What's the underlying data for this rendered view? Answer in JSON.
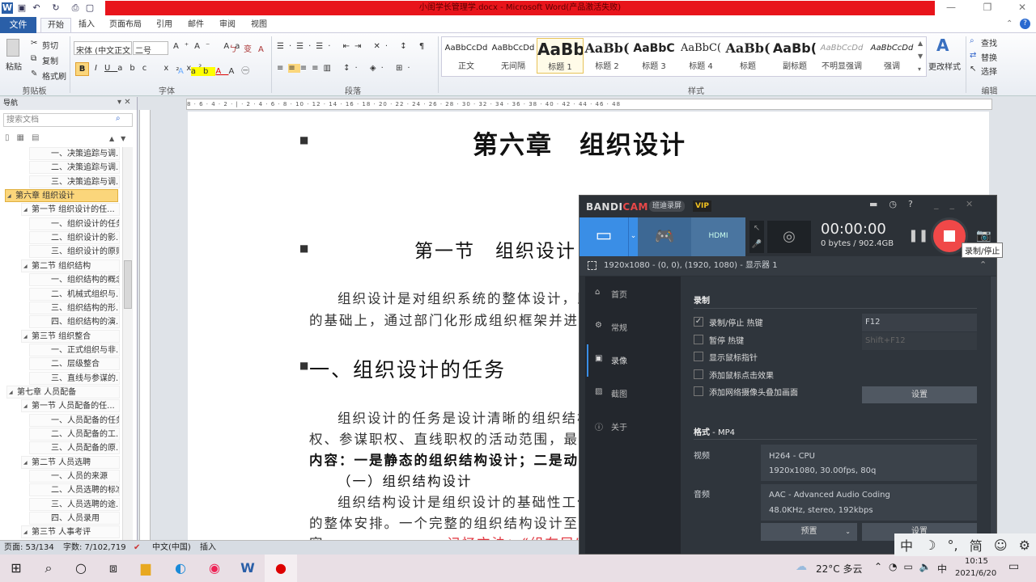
{
  "window": {
    "title": "小闺学长管理学.docx - Microsoft Word(产品激活失败)",
    "minimize": "—",
    "maximize": "❐",
    "close": "✕"
  },
  "tabs": {
    "file": "文件",
    "items": [
      "开始",
      "插入",
      "页面布局",
      "引用",
      "邮件",
      "审阅",
      "视图"
    ]
  },
  "ribbon": {
    "clipboard": {
      "label": "剪贴板",
      "paste": "粘贴",
      "cut": "剪切",
      "copy": "复制",
      "format_painter": "格式刷"
    },
    "font": {
      "label": "字体",
      "font_name": "宋体 (中文正文)",
      "font_size": "二号"
    },
    "paragraph": {
      "label": "段落"
    },
    "styles": {
      "label": "样式",
      "items": [
        {
          "preview": "AaBbCcDd",
          "name": "正文"
        },
        {
          "preview": "AaBbCcDd",
          "name": "无间隔"
        },
        {
          "preview": "AaBb",
          "name": "标题 1"
        },
        {
          "preview": "AaBb(",
          "name": "标题 2"
        },
        {
          "preview": "AaBbC",
          "name": "标题 3"
        },
        {
          "preview": "AaBbC(",
          "name": "标题 4"
        },
        {
          "preview": "AaBb(",
          "name": "标题"
        },
        {
          "preview": "AaBb(",
          "name": "副标题"
        },
        {
          "preview": "AaBbCcDd",
          "name": "不明显强调"
        },
        {
          "preview": "AaBbCcDd",
          "name": "强调"
        }
      ],
      "change": "更改样式"
    },
    "editing": {
      "label": "编辑",
      "find": "查找",
      "replace": "替换",
      "select": "选择"
    }
  },
  "nav": {
    "title": "导航",
    "search_placeholder": "搜索文档",
    "items": [
      {
        "t": "一、决策追踪与调...",
        "l": 2
      },
      {
        "t": "二、决策追踪与调...",
        "l": 2
      },
      {
        "t": "三、决策追踪与调...",
        "l": 2
      },
      {
        "t": "第六章 组织设计",
        "l": 0,
        "sel": true
      },
      {
        "t": "第一节 组织设计的任...",
        "l": 1
      },
      {
        "t": "一、组织设计的任务",
        "l": 2
      },
      {
        "t": "二、组织设计的影...",
        "l": 2
      },
      {
        "t": "三、组织设计的原则",
        "l": 2
      },
      {
        "t": "第二节 组织结构",
        "l": 1
      },
      {
        "t": "一、组织结构的概念",
        "l": 2
      },
      {
        "t": "二、机械式组织与...",
        "l": 2
      },
      {
        "t": "三、组织结构的形...",
        "l": 2
      },
      {
        "t": "四、组织结构的演...",
        "l": 2
      },
      {
        "t": "第三节 组织整合",
        "l": 1
      },
      {
        "t": "一、正式组织与非...",
        "l": 2
      },
      {
        "t": "二、层级整合",
        "l": 2
      },
      {
        "t": "三、直线与参谋的...",
        "l": 2
      },
      {
        "t": "第七章 人员配备",
        "l": 0
      },
      {
        "t": "第一节 人员配备的任...",
        "l": 1
      },
      {
        "t": "一、人员配备的任务",
        "l": 2
      },
      {
        "t": "二、人员配备的工...",
        "l": 2
      },
      {
        "t": "三、人员配备的原...",
        "l": 2
      },
      {
        "t": "第二节 人员选聘",
        "l": 1
      },
      {
        "t": "一、人员的来源",
        "l": 2
      },
      {
        "t": "二、人员选聘的标准",
        "l": 2
      },
      {
        "t": "三、人员选聘的途...",
        "l": 2
      },
      {
        "t": "四、人员录用",
        "l": 2
      },
      {
        "t": "第三节 人事考评",
        "l": 1
      }
    ]
  },
  "ruler": "8 · 6 · 4 · 2 · | · 2 · 4 · 6 · 8 · 10 · 12 · 14 · 16 · 18 · 20 · 22 · 24 · 26 · 28 · 30 · 32 · 34 · 36 · 38 · 40 · 42 · 44 · 46 · 48",
  "doc": {
    "chapter": "第六章　组织设计",
    "section": "第一节　组织设计",
    "p1a": "组织设计是对组织系统的整体设计，即按",
    "p1b": "的基础上，通过部门化形成组织框架并进行",
    "h2": "一、组织设计的任务",
    "p2a": "组织设计的任务是设计清晰的组织结构",
    "p2b": "权、参谋职权、直线职权的活动范围，最终编",
    "p2c": "内容：一是静态的组织结构设计；二是动态",
    "h3": "（一）组织结构设计",
    "p3a": "组织结构设计是组织设计的基础性工作",
    "p3b": "的整体安排。一个完整的组织结构设计至少",
    "p3c": "容",
    "p3red": "记忆方法：“组布层”"
  },
  "status": {
    "page": "页面: 53/134",
    "words": "字数: 7/102,719",
    "lang": "中文(中国)",
    "mode": "插入"
  },
  "bandicam": {
    "logo_a": "BANDI",
    "logo_b": "CAM",
    "badge": "班迪录屏",
    "vip": "VIP",
    "timer": "00:00:00",
    "size": "0 bytes / 902.4GB",
    "tooltip": "录制/停止",
    "region": "1920x1080 - (0, 0), (1920, 1080) - 显示器 1",
    "menu": [
      "首页",
      "常规",
      "录像",
      "截图",
      "关于"
    ],
    "record": {
      "title": "录制",
      "options": [
        {
          "label": "录制/停止 热键",
          "checked": true
        },
        {
          "label": "暂停 热键",
          "checked": false
        },
        {
          "label": "显示鼠标指针",
          "checked": false
        },
        {
          "label": "添加鼠标点击效果",
          "checked": false
        },
        {
          "label": "添加网络摄像头叠加画面",
          "checked": false
        }
      ],
      "hotkey1": "F12",
      "hotkey2": "Shift+F12",
      "settings": "设置"
    },
    "format": {
      "title": "格式",
      "container": " - MP4",
      "video_label": "视频",
      "video_codec": "H264 - CPU",
      "video_spec": "1920x1080, 30.00fps, 80q",
      "audio_label": "音频",
      "audio_codec": "AAC - Advanced Audio Coding",
      "audio_spec": "48.0KHz, stereo, 192kbps",
      "preset": "预置",
      "settings": "设置"
    }
  },
  "ime": [
    "中",
    "☽",
    "°,",
    "简",
    "☺",
    "⚙"
  ],
  "taskbar": {
    "weather": "22°C 多云",
    "ime": "中",
    "time": "10:15",
    "date": "2021/6/20"
  },
  "colors": {
    "accent": "#2a5fa8",
    "title_red": "#e8141b",
    "record": "#f04848",
    "bandicam_blue": "#3a8ee6"
  }
}
